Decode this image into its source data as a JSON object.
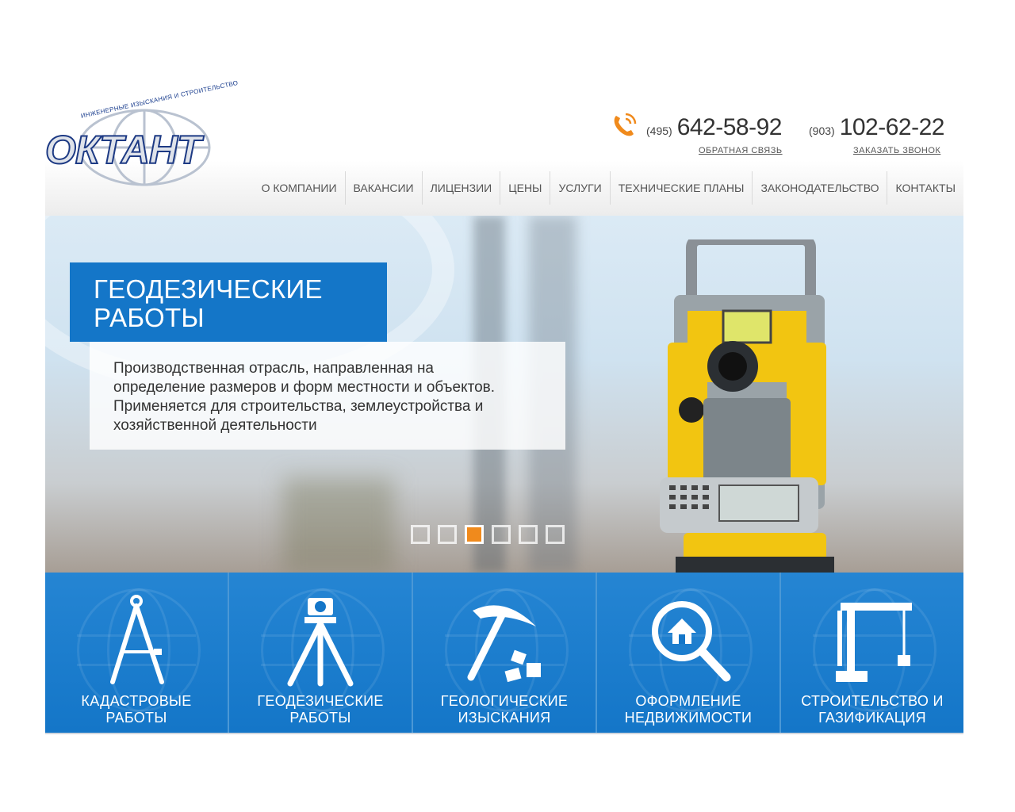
{
  "header": {
    "logo_tagline": "ИНЖЕНЕРНЫЕ ИЗЫСКАНИЯ И СТРОИТЕЛЬСТВО",
    "logo_text": "ОКТАНТ",
    "phones": [
      {
        "code": "(495)",
        "number": "642-58-92",
        "link": "ОБРАТНАЯ СВЯЗЬ"
      },
      {
        "code": "(903)",
        "number": "102-62-22",
        "link": "ЗАКАЗАТЬ ЗВОНОК"
      }
    ]
  },
  "nav": [
    "О КОМПАНИИ",
    "ВАКАНСИИ",
    "ЛИЦЕНЗИИ",
    "ЦЕНЫ",
    "УСЛУГИ",
    "ТЕХНИЧЕСКИЕ ПЛАНЫ",
    "ЗАКОНОДАТЕЛЬСТВО",
    "КОНТАКТЫ"
  ],
  "slider": {
    "title_line1": "ГЕОДЕЗИЧЕСКИЕ",
    "title_line2": "РАБОТЫ",
    "description": "Производственная отрасль, направленная на определение размеров и форм местности и объектов. Применяется для строительства, землеустройства и хозяйственной деятельности",
    "dots_count": 6,
    "active_dot": 3
  },
  "services": [
    {
      "line1": "КАДАСТРОВЫЕ",
      "line2": "РАБОТЫ",
      "icon": "compass-icon"
    },
    {
      "line1": "ГЕОДЕЗИЧЕСКИЕ",
      "line2": "РАБОТЫ",
      "icon": "tripod-icon"
    },
    {
      "line1": "ГЕОЛОГИЧЕСКИЕ",
      "line2": "ИЗЫСКАНИЯ",
      "icon": "pickaxe-icon"
    },
    {
      "line1": "ОФОРМЛЕНИЕ",
      "line2": "НЕДВИЖИМОСТИ",
      "icon": "house-search-icon"
    },
    {
      "line1": "СТРОИТЕЛЬСТВО И",
      "line2": "ГАЗИФИКАЦИЯ",
      "icon": "crane-icon"
    }
  ],
  "colors": {
    "accent_blue": "#1476c8",
    "accent_orange": "#f08a1c"
  }
}
